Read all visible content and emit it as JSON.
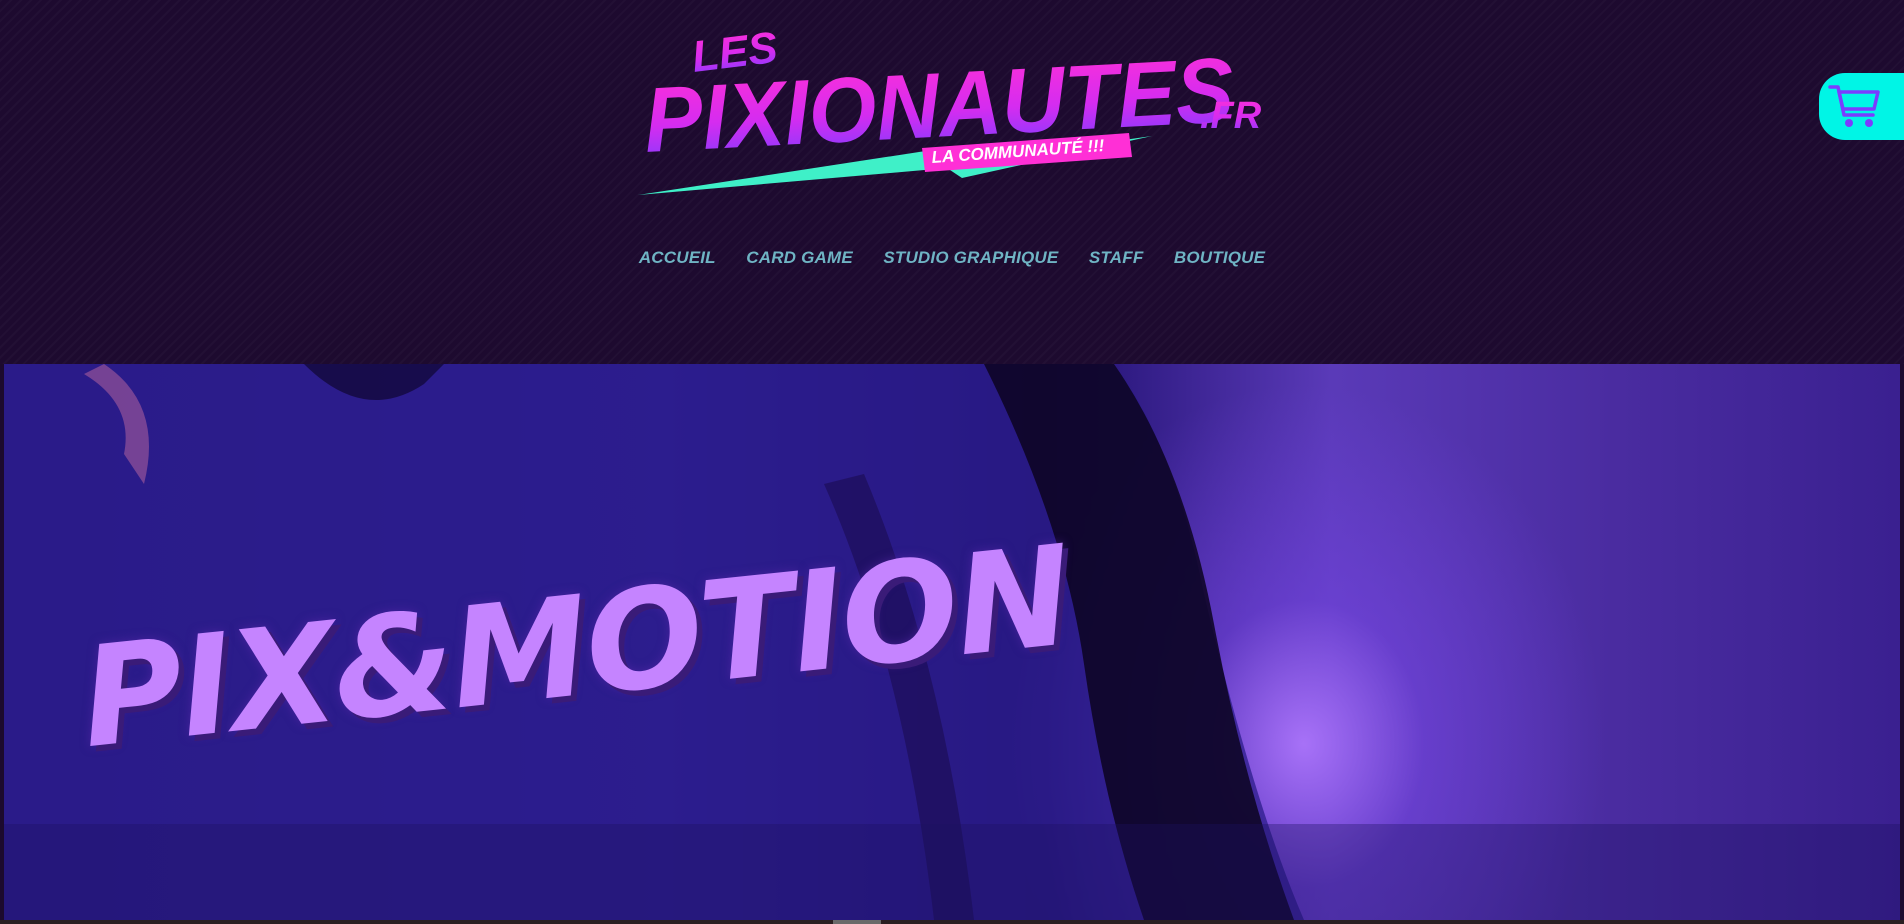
{
  "logo": {
    "line1": "LES",
    "line2": "PIXIONAUTES",
    "tld": ".FR",
    "tagline": "LA COMMUNAUTÉ !!!",
    "colors": {
      "magenta": "#ff2fd6",
      "violet": "#8a3cff",
      "cyan": "#3ff0c8"
    }
  },
  "nav": {
    "items": [
      "ACCUEIL",
      "CARD GAME",
      "STUDIO GRAPHIQUE",
      "STAFF",
      "BOUTIQUE"
    ],
    "color": "#6fb4c4"
  },
  "cart": {
    "icon": "shopping-cart-icon",
    "color": "#00f5e6"
  },
  "hero": {
    "shirt_print": "PIX&MOTION",
    "print_color": "#c584ff"
  }
}
